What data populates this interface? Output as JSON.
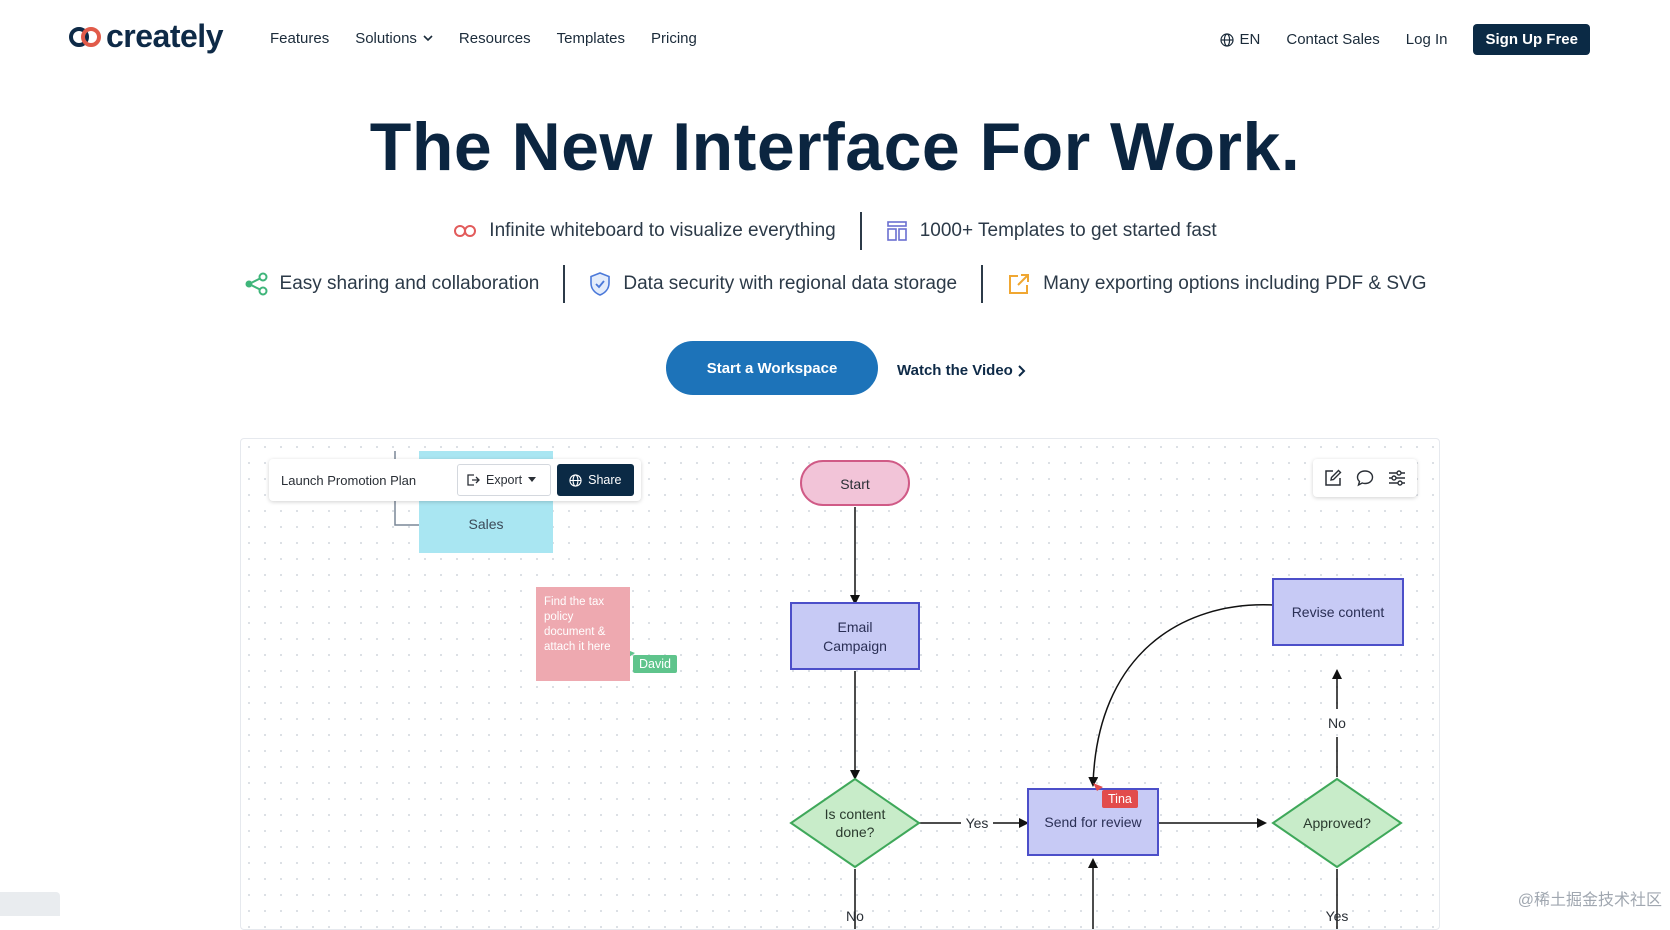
{
  "nav": {
    "logo_text": "creately",
    "links": [
      "Features",
      "Solutions",
      "Resources",
      "Templates",
      "Pricing"
    ],
    "language": "EN",
    "contact": "Contact Sales",
    "login": "Log In",
    "signup": "Sign Up Free"
  },
  "hero": {
    "title": "The New Interface For Work.",
    "features_row1": [
      "Infinite whiteboard to visualize everything",
      "1000+ Templates to get started fast"
    ],
    "features_row2": [
      "Easy sharing and collaboration",
      "Data security with regional data storage",
      "Many exporting options including PDF & SVG"
    ],
    "cta": "Start a Workspace",
    "watch": "Watch the Video"
  },
  "canvas": {
    "doc_name": "Launch Promotion Plan",
    "export_label": "Export",
    "share_label": "Share",
    "sales_label": "Sales",
    "sticky_note": "Find the tax policy document & attach it here",
    "collaborator_1": "David",
    "collaborator_2": "Tina",
    "nodes": {
      "start": "Start",
      "email_line1": "Email",
      "email_line2": "Campaign",
      "content_line1": "Is content",
      "content_line2": "done?",
      "review": "Send for review",
      "approved": "Approved?",
      "revise": "Revise content"
    },
    "edges": {
      "yes1": "Yes",
      "no1": "No",
      "no2": "No",
      "yes2": "Yes"
    }
  },
  "colors": {
    "primary_dark": "#0b2a45",
    "cta_blue": "#1d73b9",
    "node_blue_fill": "#c7caf5",
    "node_blue_stroke": "#4c4fc9",
    "decision_fill": "#c8ecc9",
    "decision_stroke": "#3fa85a",
    "start_fill": "#f2c4d8",
    "start_stroke": "#d05a86",
    "sales_fill": "#a9e6f2"
  },
  "watermark": "@稀土掘金技术社区"
}
